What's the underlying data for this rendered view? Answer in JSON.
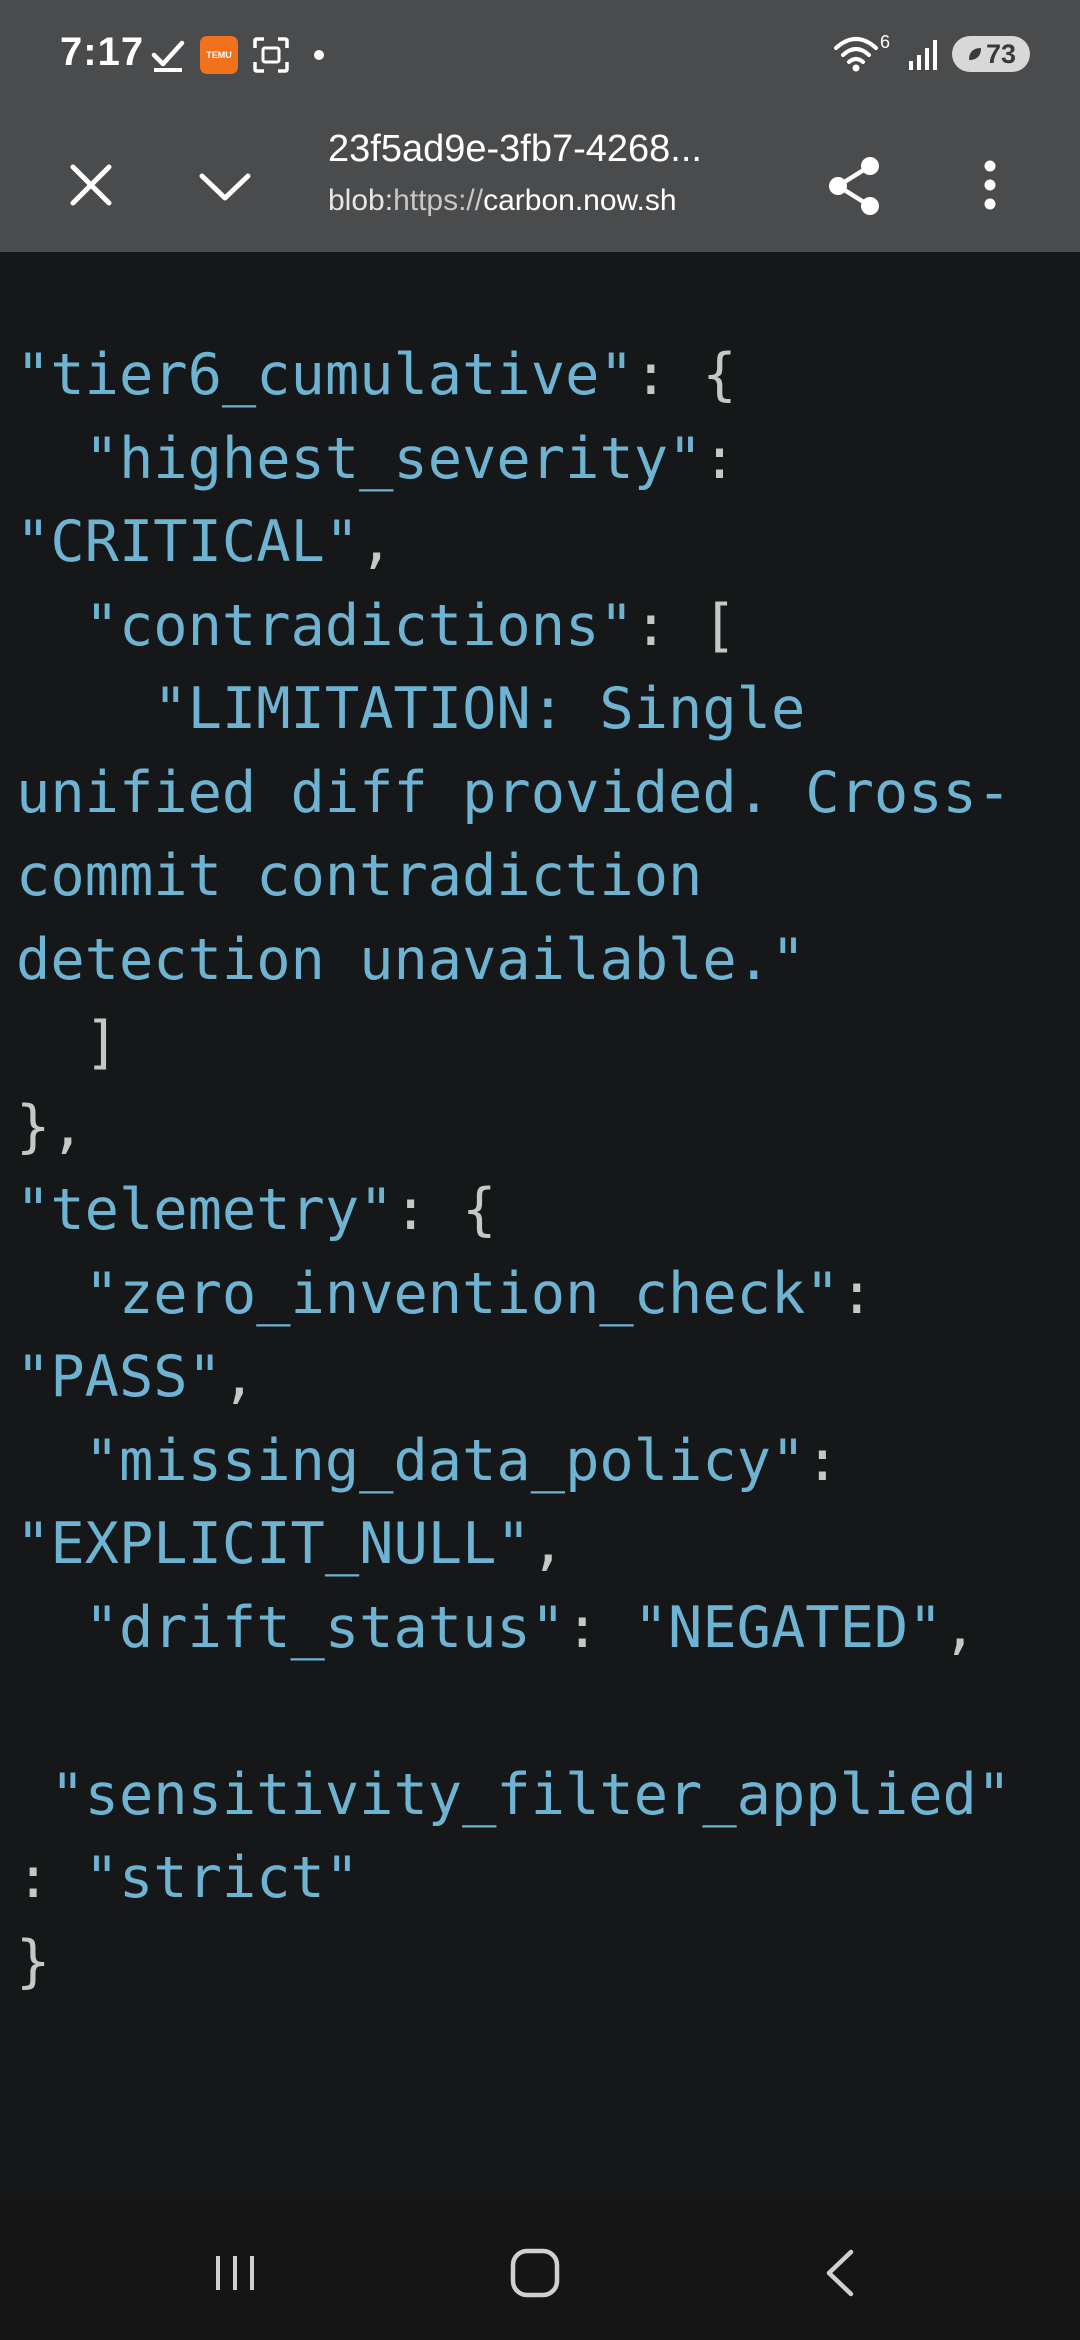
{
  "status_bar": {
    "time": "7:17",
    "temu_badge_text": "TEMU",
    "network_superscript": "6",
    "battery_level": "73",
    "icons": [
      "check-icon",
      "temu-app-icon",
      "screenshot-icon",
      "notification-dot-icon",
      "wifi-icon",
      "signal-icon",
      "battery-saver-icon"
    ]
  },
  "toolbar": {
    "title": "23f5ad9e-3fb7-4268...",
    "url_scheme": "blob:",
    "url_proto": "https://",
    "url_host": "carbon.now.sh",
    "icons": [
      "close-icon",
      "chevron-down-icon",
      "share-icon",
      "more-vert-icon"
    ]
  },
  "code": {
    "lines": [
      [
        [
          "s",
          "\"tier6_cumulative\""
        ],
        [
          "p",
          ": {"
        ]
      ],
      [
        [
          "s",
          "  \"highest_severity\""
        ],
        [
          "p",
          ":"
        ]
      ],
      [
        [
          "s",
          "\"CRITICAL\""
        ],
        [
          "p",
          ","
        ]
      ],
      [
        [
          "s",
          "  \"contradictions\""
        ],
        [
          "p",
          ": ["
        ]
      ],
      [
        [
          "s",
          "    \"LIMITATION: Single"
        ]
      ],
      [
        [
          "s",
          "unified diff provided. Cross-"
        ]
      ],
      [
        [
          "s",
          "commit contradiction"
        ]
      ],
      [
        [
          "s",
          "detection unavailable.\""
        ]
      ],
      [
        [
          "p",
          "  ]"
        ]
      ],
      [
        [
          "p",
          "},"
        ]
      ],
      [
        [
          "s",
          "\"telemetry\""
        ],
        [
          "p",
          ": {"
        ]
      ],
      [
        [
          "s",
          "  \"zero_invention_check\""
        ],
        [
          "p",
          ":"
        ]
      ],
      [
        [
          "s",
          "\"PASS\""
        ],
        [
          "p",
          ","
        ]
      ],
      [
        [
          "s",
          "  \"missing_data_policy\""
        ],
        [
          "p",
          ":"
        ]
      ],
      [
        [
          "s",
          "\"EXPLICIT_NULL\""
        ],
        [
          "p",
          ","
        ]
      ],
      [
        [
          "s",
          "  \"drift_status\""
        ],
        [
          "p",
          ": "
        ],
        [
          "s",
          "\"NEGATED\""
        ],
        [
          "p",
          ","
        ]
      ],
      [
        [
          "p",
          ""
        ]
      ],
      [
        [
          "s",
          " \"sensitivity_filter_applied\""
        ]
      ],
      [
        [
          "p",
          ": "
        ],
        [
          "s",
          "\"strict\""
        ]
      ],
      [
        [
          "p",
          "}"
        ]
      ]
    ]
  },
  "nav_bar": {
    "icons": [
      "recent-apps-icon",
      "home-icon",
      "back-icon"
    ]
  },
  "colors": {
    "toolbar_bg": "#4a4b4c",
    "code_bg": "#151718",
    "string_color": "#6fb3d2",
    "punct_color": "#c5c8c6"
  }
}
